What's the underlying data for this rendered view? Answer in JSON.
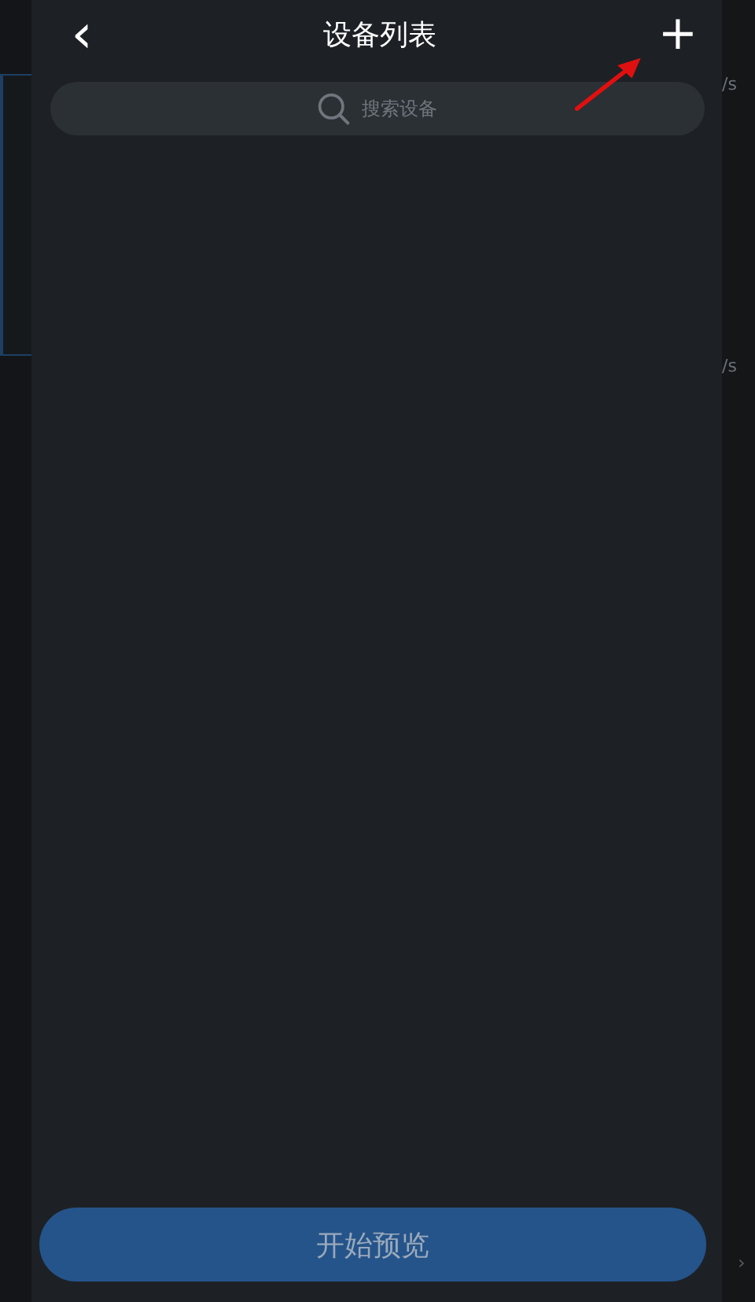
{
  "header": {
    "back": "‹",
    "title": "设备列表",
    "add": "+"
  },
  "search": {
    "placeholder": "搜索设备"
  },
  "buttons": [
    {
      "label": "开始预览"
    }
  ],
  "background_app": {
    "rate_labels": [
      "/s",
      "/s"
    ],
    "chevron": "›"
  }
}
